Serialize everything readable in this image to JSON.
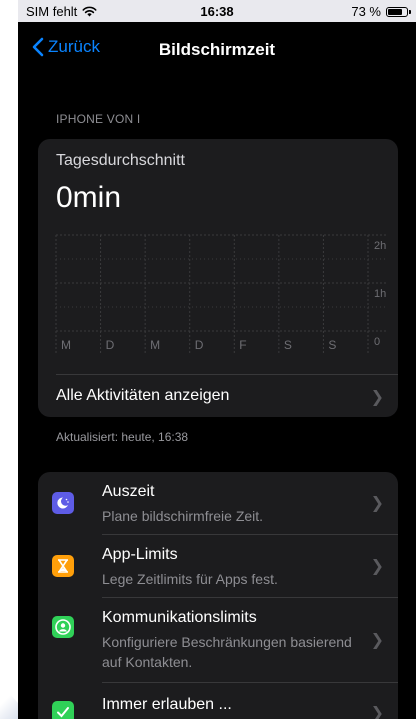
{
  "status_bar": {
    "carrier": "SIM fehlt",
    "time": "16:38",
    "battery": "73 %"
  },
  "nav": {
    "back_label": "Zurück",
    "title": "Bildschirmzeit"
  },
  "device_header": "IPHONE VON I",
  "summary": {
    "label": "Tagesdurchschnitt",
    "value": "0min",
    "all_activity_label": "Alle Aktivitäten anzeigen"
  },
  "chart_data": {
    "type": "bar",
    "categories": [
      "M",
      "D",
      "M",
      "D",
      "F",
      "S",
      "S"
    ],
    "values": [
      0,
      0,
      0,
      0,
      0,
      0,
      0
    ],
    "y_tick_labels": [
      "2h",
      "1h",
      "0"
    ],
    "ylim": [
      0,
      2
    ],
    "grid": true
  },
  "updated_text": "Aktualisiert: heute, 16:38",
  "settings": [
    {
      "title": "Auszeit",
      "subtitle": "Plane bildschirmfreie Zeit.",
      "icon": "downtime-icon",
      "color": "#5e5ce6"
    },
    {
      "title": "App-Limits",
      "subtitle": "Lege Zeitlimits für Apps fest.",
      "icon": "hourglass-icon",
      "color": "#ff9f0a"
    },
    {
      "title": "Kommunikationslimits",
      "subtitle": "Konfiguriere Beschränkungen basierend auf Kontakten.",
      "icon": "contact-icon",
      "color": "#30d158"
    },
    {
      "title": "Immer erlauben ...",
      "subtitle": "",
      "icon": "checkmark-icon",
      "color": "#30d158"
    }
  ],
  "colors": {
    "accent": "#0a84ff",
    "background": "#000000",
    "card": "#1c1c1e"
  }
}
